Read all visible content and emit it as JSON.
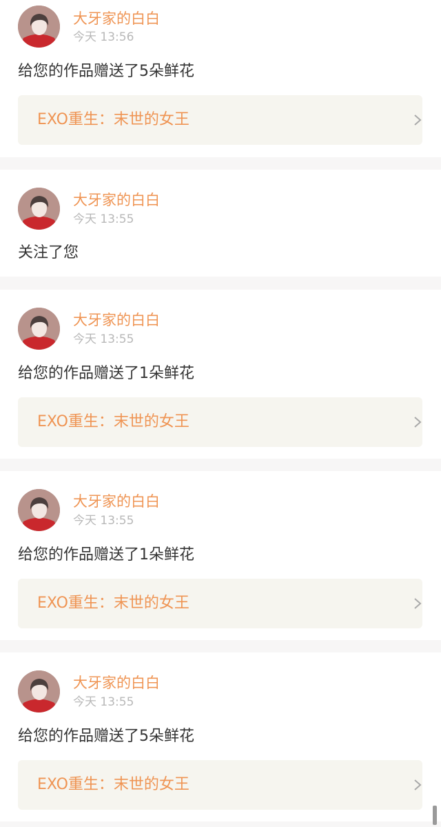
{
  "theme": {
    "accent": "#ef9453",
    "text": "#333333",
    "muted": "#b8b8b8",
    "card_bg": "#ffffff",
    "link_bg": "#f6f5ef",
    "page_bg": "#f7f6f6"
  },
  "notifications": [
    {
      "username": "大牙家的白白",
      "timestamp": "今天 13:56",
      "message": "给您的作品赠送了5朵鲜花",
      "work_title": "EXO重生：末世的女王",
      "avatar_icon": "avatar-icon",
      "chevron_icon": "chevron-right-icon"
    },
    {
      "username": "大牙家的白白",
      "timestamp": "今天 13:55",
      "message": "关注了您",
      "avatar_icon": "avatar-icon"
    },
    {
      "username": "大牙家的白白",
      "timestamp": "今天 13:55",
      "message": "给您的作品赠送了1朵鲜花",
      "work_title": "EXO重生：末世的女王",
      "avatar_icon": "avatar-icon",
      "chevron_icon": "chevron-right-icon"
    },
    {
      "username": "大牙家的白白",
      "timestamp": "今天 13:55",
      "message": "给您的作品赠送了1朵鲜花",
      "work_title": "EXO重生：末世的女王",
      "avatar_icon": "avatar-icon",
      "chevron_icon": "chevron-right-icon"
    },
    {
      "username": "大牙家的白白",
      "timestamp": "今天 13:55",
      "message": "给您的作品赠送了5朵鲜花",
      "work_title": "EXO重生：末世的女王",
      "avatar_icon": "avatar-icon",
      "chevron_icon": "chevron-right-icon"
    }
  ]
}
